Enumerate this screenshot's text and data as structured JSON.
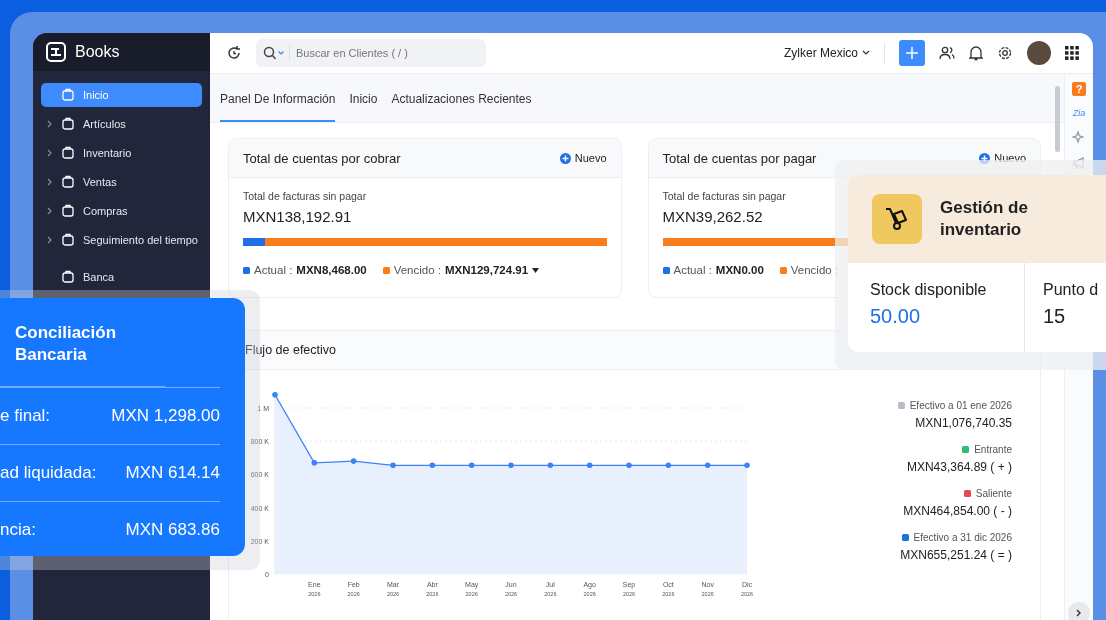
{
  "app": {
    "name": "Books"
  },
  "sidebar": {
    "items": [
      {
        "label": "Inicio",
        "kind": "link",
        "selected": true
      },
      {
        "label": "Artículos",
        "kind": "group",
        "selected": false
      },
      {
        "label": "Inventario",
        "kind": "group",
        "selected": false
      },
      {
        "label": "Ventas",
        "kind": "group",
        "selected": false
      },
      {
        "label": "Compras",
        "kind": "group",
        "selected": false
      },
      {
        "label": "Seguimiento del tiempo",
        "kind": "group",
        "selected": false
      },
      {
        "label": "Banca",
        "kind": "link",
        "selected": false
      }
    ]
  },
  "topbar": {
    "search": {
      "placeholder": "Buscar en Clientes ( / )"
    },
    "organization": "Zylker Mexico"
  },
  "tabs": [
    {
      "label": "Panel De Información",
      "selected": true
    },
    {
      "label": "Inicio",
      "selected": false
    },
    {
      "label": "Actualizaciones Recientes",
      "selected": false
    }
  ],
  "right_rail": {
    "help": "?",
    "logo": "Zia"
  },
  "summary_cards": [
    {
      "title": "Total de cuentas por cobrar",
      "action": "Nuevo",
      "subtitle": "Total de facturas sin pagar",
      "amount": "MXN138,192.91",
      "level": 0.939,
      "legend": [
        {
          "label": "Actual :",
          "value": "MXN8,468.00",
          "color": "#1f6fe5",
          "dropdown": false
        },
        {
          "label": "Vencido :",
          "value": "MXN129,724.91",
          "color": "#fb7d1a",
          "dropdown": true
        }
      ]
    },
    {
      "title": "Total de cuentas por pagar",
      "action": "Nuevo",
      "subtitle": "Total de facturas sin pagar",
      "amount": "MXN39,262.52",
      "level": 1,
      "legend": [
        {
          "label": "Actual :",
          "value": "MXN0.00",
          "color": "#1f6fe5",
          "dropdown": false
        },
        {
          "label": "Vencido :",
          "color": "#fb7d1a",
          "dropdown": false
        }
      ]
    }
  ],
  "cash_flow": {
    "title": "Flujo de efectivo",
    "chart_data": {
      "type": "area",
      "categories": [
        null,
        "Ene $_{2026}$",
        "Feb $_{2026}$",
        "Mar $_{2026}$",
        "Abr $_{2026}$",
        "May $_{2026}$",
        "Jun $_{2026}$",
        "Jul $_{2026}$",
        "Ago $_{2026}$",
        "Sep $_{2026}$",
        "Oct $_{2026}$",
        "Nov $_{2026}$",
        "Dic $_{2026}$"
      ],
      "yticks": [
        {
          "value": 0,
          "label": "0"
        },
        {
          "value": 200000,
          "label": "200 K"
        },
        {
          "value": 400000,
          "label": "400 K"
        },
        {
          "value": 600000,
          "label": "600 K"
        },
        {
          "value": 800000,
          "label": "800 K"
        },
        {
          "value": 1000000,
          "label": "1 M"
        }
      ],
      "ylim": [
        0,
        1100000
      ],
      "series": [
        {
          "color": "#3b82f6",
          "values": [
            1080000,
            670000,
            680000,
            655000,
            655000,
            655000,
            655000,
            655000,
            655000,
            655000,
            655000,
            655000,
            655000
          ]
        }
      ]
    },
    "legend": [
      {
        "label": "Efectivo a 01 ene 2026",
        "value": "MXN1,076,740.35",
        "color": "#b9bdc9"
      },
      {
        "label": "Entrante",
        "value": "MXN43,364.89 ( + )",
        "color": "#2fbf71"
      },
      {
        "label": "Saliente",
        "value": "MXN464,854.00 ( - )",
        "color": "#e5484d"
      },
      {
        "label": "Efectivo a 31 dic 2026",
        "value": "MXN655,251.24 ( = )",
        "color": "#1f6fe5"
      }
    ]
  },
  "bank_reconciliation": {
    "title": "Conciliación Bancaria",
    "rows": [
      {
        "label": "e final:",
        "value": "MXN 1,298.00"
      },
      {
        "label": "ad liquidada:",
        "value": "MXN 614.14"
      },
      {
        "label": "ncia:",
        "value": "MXN 683.86"
      }
    ]
  },
  "inventory": {
    "title": "Gestión de inventario",
    "stats": [
      {
        "label": "Stock disponible",
        "value": "50.00",
        "highlight": true
      },
      {
        "label": "Punto d",
        "value": "15",
        "highlight": false
      }
    ]
  }
}
